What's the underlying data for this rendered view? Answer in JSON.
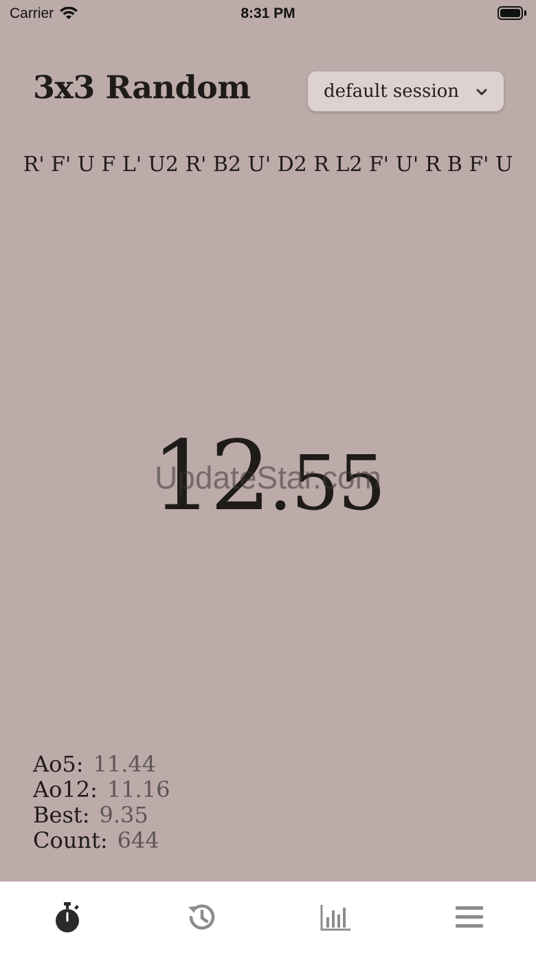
{
  "status_bar": {
    "carrier": "Carrier",
    "time": "8:31 PM",
    "battery_level": 1.0
  },
  "header": {
    "title": "3x3 Random",
    "session": "default session",
    "session_icon": "chevron-down-icon"
  },
  "scramble": "R' F' U F L' U2 R' B2 U' D2 R L2 F' U' R B F' U",
  "timer": {
    "whole": "12",
    "fraction": ".55"
  },
  "watermark": "UpdateStar.com",
  "stats": [
    {
      "label": "Ao5:",
      "value": "11.44"
    },
    {
      "label": "Ao12:",
      "value": "11.16"
    },
    {
      "label": "Best:",
      "value": "9.35"
    },
    {
      "label": "Count:",
      "value": "644"
    }
  ],
  "tabs": [
    {
      "name": "timer",
      "icon": "stopwatch-icon",
      "active": true
    },
    {
      "name": "history",
      "icon": "history-icon",
      "active": false
    },
    {
      "name": "stats",
      "icon": "bar-chart-icon",
      "active": false
    },
    {
      "name": "menu",
      "icon": "menu-icon",
      "active": false
    }
  ],
  "colors": {
    "background": "#bcaba8",
    "tab_active": "#2a2a2a",
    "tab_inactive": "#8c8c8c"
  }
}
